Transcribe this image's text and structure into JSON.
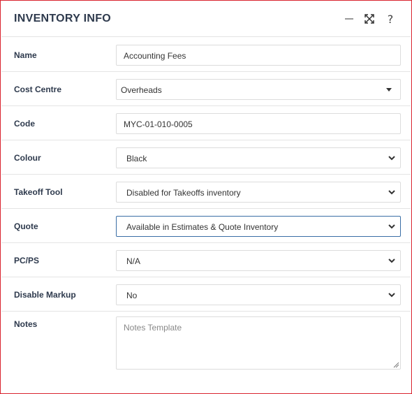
{
  "header": {
    "title": "INVENTORY INFO",
    "help_label": "?"
  },
  "fields": {
    "name": {
      "label": "Name",
      "value": "Accounting Fees"
    },
    "cost_centre": {
      "label": "Cost Centre",
      "value": "Overheads"
    },
    "code": {
      "label": "Code",
      "value": "MYC-01-010-0005"
    },
    "colour": {
      "label": "Colour",
      "value": "Black"
    },
    "takeoff_tool": {
      "label": "Takeoff Tool",
      "value": "Disabled for Takeoffs inventory"
    },
    "quote": {
      "label": "Quote",
      "value": "Available in Estimates & Quote Inventory"
    },
    "pcps": {
      "label": "PC/PS",
      "value": "N/A"
    },
    "disable_markup": {
      "label": "Disable Markup",
      "value": "No"
    },
    "notes": {
      "label": "Notes",
      "placeholder": "Notes Template"
    }
  },
  "colors": {
    "border_accent": "#d9232e",
    "corner_accent": "#2f5d8a",
    "label_text": "#2e3a4d",
    "active_border": "#3a6ea5"
  },
  "icons": {
    "minimize": "minimize-icon",
    "expand": "expand-icon",
    "help": "help-icon",
    "select_arrow": "chevron-down-icon",
    "dropdown_caret": "caret-down-icon"
  }
}
